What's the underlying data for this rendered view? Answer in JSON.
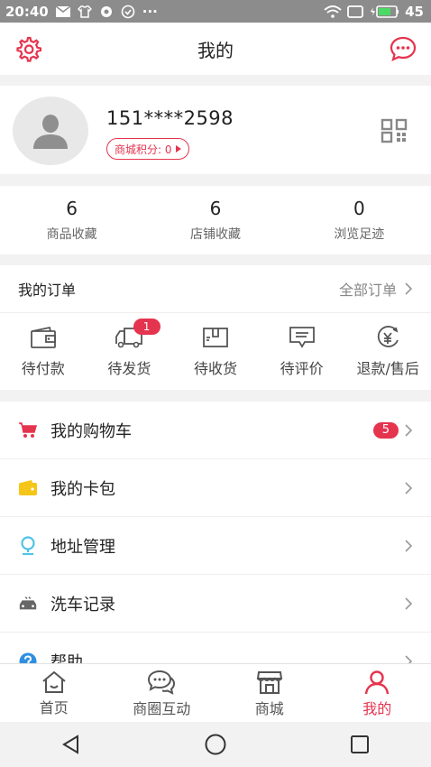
{
  "status_bar": {
    "time": "20:40",
    "dots": "···",
    "battery": "45"
  },
  "header": {
    "title": "我的"
  },
  "profile": {
    "phone": "151****2598",
    "points_label": "商城积分: 0"
  },
  "stats": [
    {
      "num": "6",
      "label": "商品收藏"
    },
    {
      "num": "6",
      "label": "店铺收藏"
    },
    {
      "num": "0",
      "label": "浏览足迹"
    }
  ],
  "orders": {
    "title": "我的订单",
    "all_label": "全部订单",
    "items": [
      {
        "label": "待付款",
        "icon": "wallet-icon"
      },
      {
        "label": "待发货",
        "icon": "truck-icon",
        "badge": "1"
      },
      {
        "label": "待收货",
        "icon": "box-icon"
      },
      {
        "label": "待评价",
        "icon": "comment-icon"
      },
      {
        "label": "退款/售后",
        "icon": "refund-icon"
      }
    ]
  },
  "menu": [
    {
      "label": "我的购物车",
      "icon": "cart-icon",
      "count": "5"
    },
    {
      "label": "我的卡包",
      "icon": "card-wallet-icon"
    },
    {
      "label": "地址管理",
      "icon": "location-icon"
    },
    {
      "label": "洗车记录",
      "icon": "car-icon"
    },
    {
      "label": "帮助",
      "icon": "help-icon"
    }
  ],
  "tabs": [
    {
      "label": "首页",
      "icon": "home-icon"
    },
    {
      "label": "商圈互动",
      "icon": "chat-icon"
    },
    {
      "label": "商城",
      "icon": "shop-icon"
    },
    {
      "label": "我的",
      "icon": "user-icon",
      "active": true
    }
  ],
  "colors": {
    "accent": "#e5344e",
    "cart": "#e5344e",
    "card": "#f5c518",
    "location": "#4fc3e8",
    "help": "#2f8fe0"
  }
}
